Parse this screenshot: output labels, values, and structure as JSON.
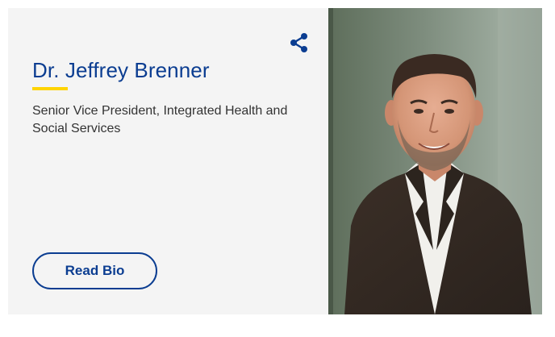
{
  "profile": {
    "name": "Dr. Jeffrey Brenner",
    "title": "Senior Vice President, Integrated Health and Social Services",
    "read_bio_label": "Read Bio",
    "share_icon": "share-icon",
    "photo_alt": "Dr. Jeffrey Brenner"
  },
  "colors": {
    "brand_blue": "#0b3d91",
    "accent_yellow": "#ffd400",
    "card_background": "#f4f4f4"
  }
}
